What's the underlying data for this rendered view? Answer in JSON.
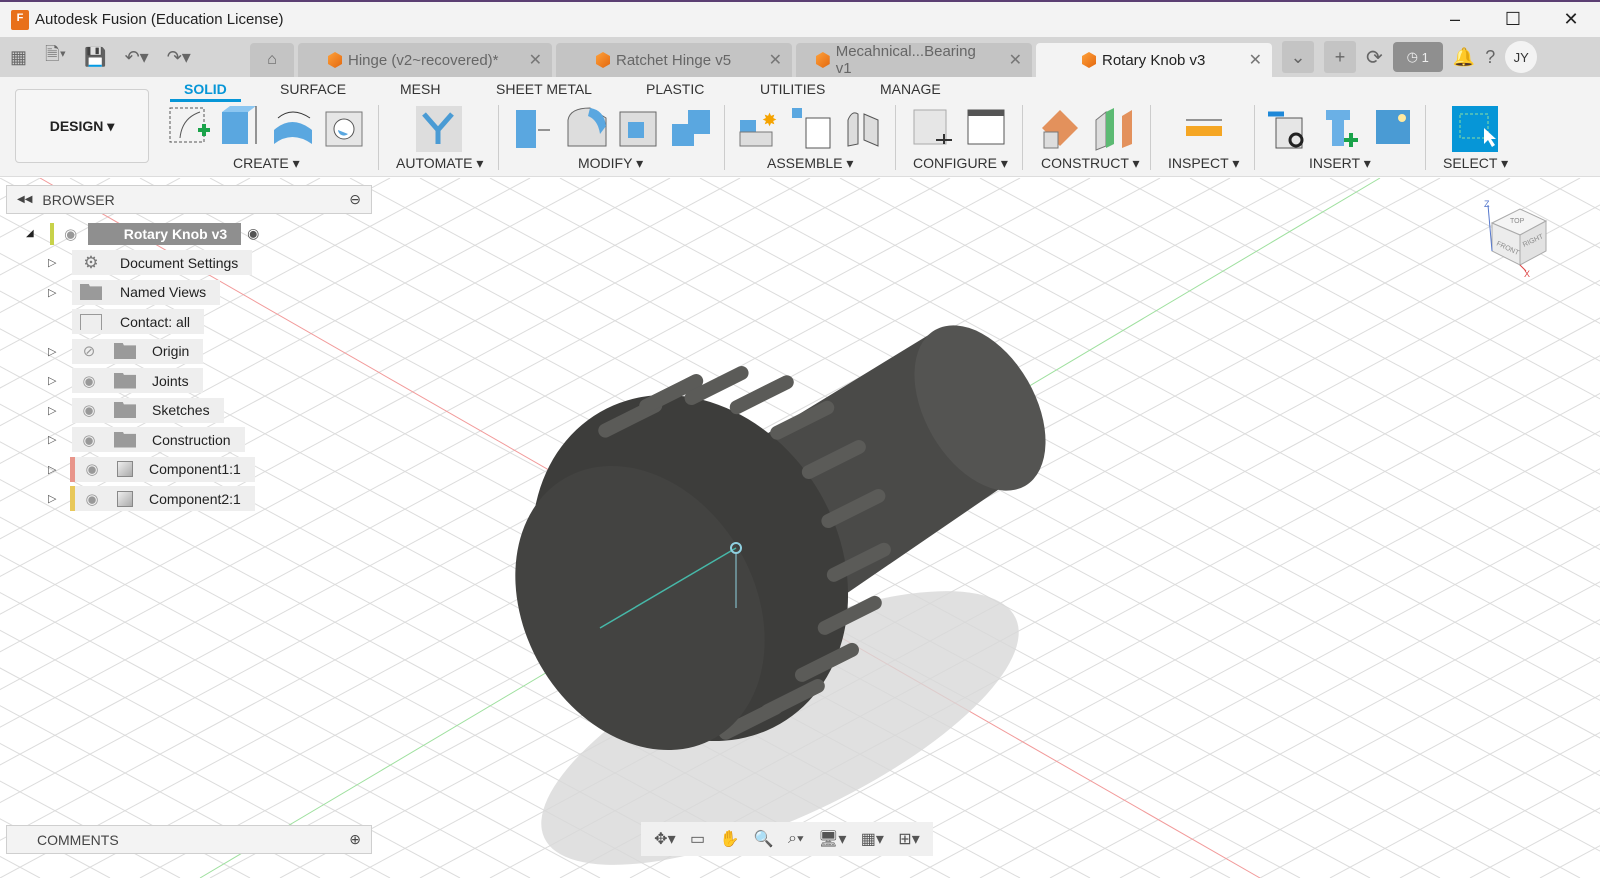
{
  "window": {
    "title": "Autodesk Fusion (Education License)",
    "app_icon": "F",
    "minimize": "–",
    "maximize": "☐",
    "close": "✕"
  },
  "tabs": [
    {
      "label": "Hinge (v2~recovered)*",
      "close": "✕"
    },
    {
      "label": "Ratchet Hinge v5",
      "close": "✕"
    },
    {
      "label": "Mecahnical...Bearing v1",
      "close": "✕"
    },
    {
      "label": "Rotary Knob v3",
      "close": "✕",
      "active": true
    }
  ],
  "toolbar_right": {
    "jobs_count": "1",
    "user_initials": "JY"
  },
  "ribbon": {
    "workspace": "DESIGN ▾",
    "tabs": [
      "SOLID",
      "SURFACE",
      "MESH",
      "SHEET METAL",
      "PLASTIC",
      "UTILITIES",
      "MANAGE"
    ],
    "groups": [
      "CREATE ▾",
      "AUTOMATE ▾",
      "MODIFY ▾",
      "ASSEMBLE ▾",
      "CONFIGURE ▾",
      "CONSTRUCT ▾",
      "INSPECT ▾",
      "INSERT ▾",
      "SELECT ▾"
    ]
  },
  "browser": {
    "title": "BROWSER",
    "root": "Rotary Knob v3",
    "items": [
      {
        "label": "Document Settings",
        "icon": "gear-icon"
      },
      {
        "label": "Named Views",
        "icon": "folder-icon"
      },
      {
        "label": "Contact: all",
        "icon": "contact-icon"
      },
      {
        "label": "Origin",
        "icon": "folder-icon",
        "hidden": true
      },
      {
        "label": "Joints",
        "icon": "folder-icon"
      },
      {
        "label": "Sketches",
        "icon": "folder-icon"
      },
      {
        "label": "Construction",
        "icon": "folder-icon"
      },
      {
        "label": "Component1:1",
        "icon": "component-icon",
        "color": "#e8958a"
      },
      {
        "label": "Component2:1",
        "icon": "component-icon",
        "color": "#e8c85a"
      }
    ]
  },
  "comments": {
    "title": "COMMENTS"
  },
  "viewcube": {
    "top": "TOP",
    "front": "FRONT",
    "right": "RIGHT",
    "z": "Z",
    "x": "X"
  },
  "colors": {
    "accent": "#0696d7",
    "body": "#4a4a48"
  }
}
